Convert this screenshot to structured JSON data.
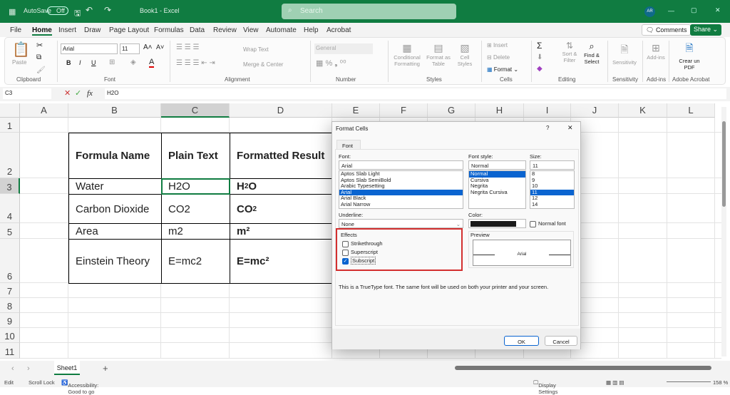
{
  "titlebar": {
    "autosave": "AutoSave",
    "autosave_state": "Off",
    "title": "Book1 - Excel",
    "search_placeholder": "Search",
    "avatar": "AR",
    "minimize": "—",
    "restore": "▢",
    "close": "✕"
  },
  "menu": {
    "items": [
      "File",
      "Home",
      "Insert",
      "Draw",
      "Page Layout",
      "Formulas",
      "Data",
      "Review",
      "View",
      "Automate",
      "Help",
      "Acrobat"
    ],
    "active": "Home",
    "comments": "Comments",
    "share": "Share"
  },
  "ribbon": {
    "clipboard": {
      "paste": "Paste",
      "label": "Clipboard"
    },
    "font": {
      "name": "Arial",
      "size": "11",
      "bold": "B",
      "italic": "I",
      "underline": "U",
      "label": "Font"
    },
    "alignment": {
      "wrap": "Wrap Text",
      "merge": "Merge & Center",
      "label": "Alignment"
    },
    "number": {
      "format": "General",
      "label": "Number"
    },
    "styles": {
      "conditional": "Conditional Formatting",
      "format_table": "Format as Table",
      "cell_styles": "Cell Styles",
      "label": "Styles"
    },
    "cells": {
      "insert": "Insert",
      "delete": "Delete",
      "format": "Format",
      "label": "Cells"
    },
    "editing": {
      "sort": "Sort & Filter",
      "find": "Find & Select",
      "label": "Editing"
    },
    "sensitivity": {
      "button": "Sensitivity",
      "label": "Sensitivity"
    },
    "addins": {
      "button": "Add-ins",
      "label": "Add-ins"
    },
    "acrobat": {
      "button": "Crear un PDF",
      "label": "Adobe Acrobat"
    }
  },
  "formula_bar": {
    "name_box": "C3",
    "fx": "fx",
    "value": "H2O"
  },
  "columns": [
    "A",
    "B",
    "C",
    "D",
    "E",
    "F",
    "G",
    "H",
    "I",
    "J",
    "K",
    "L"
  ],
  "rows": [
    "1",
    "2",
    "3",
    "4",
    "5",
    "6",
    "7",
    "8",
    "9",
    "10",
    "11"
  ],
  "table": {
    "headers": [
      "Formula Name",
      "Plain Text",
      "Formatted Result"
    ],
    "rows": [
      {
        "name": "Water",
        "plain": "H2O",
        "result_parts": [
          "H",
          "2",
          "O"
        ]
      },
      {
        "name": "Carbon Dioxide",
        "plain": "CO2",
        "result_parts": [
          "CO",
          "2",
          ""
        ]
      },
      {
        "name": "Area",
        "plain": "m2",
        "result": "m²"
      },
      {
        "name": "Einstein Theory",
        "plain": "E=mc2",
        "result": "E=mc²"
      }
    ]
  },
  "dialog": {
    "title": "Format Cells",
    "help": "?",
    "close": "✕",
    "tab": "Font",
    "font_label": "Font:",
    "font_value": "Arial",
    "font_list": [
      "Aptos Slab Light",
      "Aptos Slab SemiBold",
      "Arabic Typesetting",
      "Arial",
      "Arial Black",
      "Arial Narrow"
    ],
    "font_selected": 3,
    "style_label": "Font style:",
    "style_value": "Normal",
    "style_list": [
      "Normal",
      "Cursiva",
      "Negrita",
      "Negrita Cursiva"
    ],
    "style_selected": 0,
    "size_label": "Size:",
    "size_value": "11",
    "size_list": [
      "8",
      "9",
      "10",
      "11",
      "12",
      "14"
    ],
    "size_selected": 3,
    "underline_label": "Underline:",
    "underline_value": "None",
    "color_label": "Color:",
    "color_value": "#1a1a1a",
    "normal_font": "Normal font",
    "effects_label": "Effects",
    "strikethrough": "Strikethrough",
    "superscript": "Superscript",
    "subscript": "Subscript",
    "effects": {
      "strikethrough": false,
      "superscript": false,
      "subscript": true
    },
    "preview_label": "Preview",
    "preview_text": "Arial",
    "info": "This is a TrueType font.  The same font will be used on both your printer and your screen.",
    "ok": "OK",
    "cancel": "Cancel",
    "highlight_color": "#d32f2f"
  },
  "sheet_tabs": {
    "active": "Sheet1",
    "add": "+"
  },
  "status": {
    "mode": "Edit",
    "scroll_lock": "Scroll Lock",
    "accessibility": "Accessibility: Good to go",
    "display_settings": "Display Settings",
    "zoom": "158 %"
  },
  "colors": {
    "brand": "#107c41",
    "selection": "#0a64d0"
  }
}
